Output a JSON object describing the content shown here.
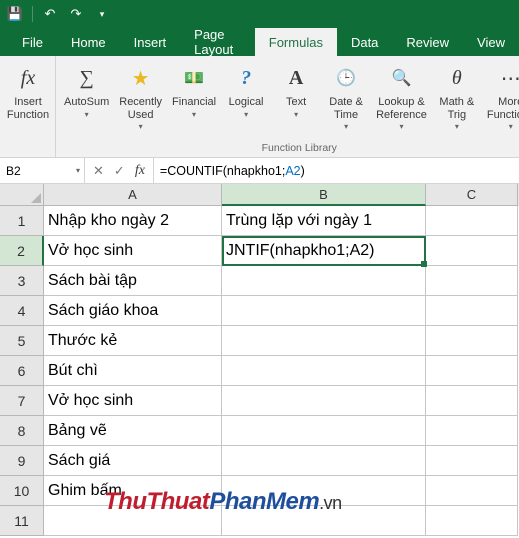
{
  "qat": {
    "save": "💾",
    "undo": "↶",
    "redo": "↷",
    "more": "▾"
  },
  "tabs": [
    "File",
    "Home",
    "Insert",
    "Page Layout",
    "Formulas",
    "Data",
    "Review",
    "View"
  ],
  "active_tab": 4,
  "ribbon": {
    "groups": [
      {
        "label": "",
        "buttons": [
          {
            "name": "insert-function",
            "icon": "fx",
            "label": "Insert\nFunction",
            "dd": false
          }
        ]
      },
      {
        "label": "Function Library",
        "buttons": [
          {
            "name": "autosum",
            "icon": "∑",
            "label": "AutoSum",
            "dd": true
          },
          {
            "name": "recently-used",
            "icon": "★",
            "label": "Recently\nUsed",
            "dd": true
          },
          {
            "name": "financial",
            "icon": "💵",
            "label": "Financial",
            "dd": true
          },
          {
            "name": "logical",
            "icon": "?",
            "label": "Logical",
            "dd": true
          },
          {
            "name": "text",
            "icon": "A",
            "label": "Text",
            "dd": true
          },
          {
            "name": "date-time",
            "icon": "🕒",
            "label": "Date &\nTime",
            "dd": true
          },
          {
            "name": "lookup-reference",
            "icon": "🔍",
            "label": "Lookup &\nReference",
            "dd": true
          },
          {
            "name": "math-trig",
            "icon": "θ",
            "label": "Math &\nTrig",
            "dd": true
          },
          {
            "name": "more-functions",
            "icon": "⋯",
            "label": "More\nFunctions",
            "dd": true
          }
        ]
      }
    ]
  },
  "namebox": "B2",
  "formula": {
    "pre": "=COUNTIF(nhapkho1;",
    "ref": "A2",
    "post": ")"
  },
  "cols": [
    "A",
    "B",
    "C"
  ],
  "rows": [
    {
      "n": "1",
      "a": "Nhập kho ngày 2",
      "b": "Trùng lặp với ngày 1",
      "c": ""
    },
    {
      "n": "2",
      "a": "Vở học sinh",
      "b": "JNTIF(nhapkho1;A2)",
      "c": ""
    },
    {
      "n": "3",
      "a": "Sách bài tập",
      "b": "",
      "c": ""
    },
    {
      "n": "4",
      "a": "Sách giáo khoa",
      "b": "",
      "c": ""
    },
    {
      "n": "5",
      "a": "Thước kẻ",
      "b": "",
      "c": ""
    },
    {
      "n": "6",
      "a": "Bút chì",
      "b": "",
      "c": ""
    },
    {
      "n": "7",
      "a": "Vở học sinh",
      "b": "",
      "c": ""
    },
    {
      "n": "8",
      "a": "Bảng vẽ",
      "b": "",
      "c": ""
    },
    {
      "n": "9",
      "a": "Sách giá",
      "b": "",
      "c": ""
    },
    {
      "n": "10",
      "a": "Ghim bấm",
      "b": "",
      "c": ""
    },
    {
      "n": "11",
      "a": "",
      "b": "",
      "c": ""
    }
  ],
  "watermark": {
    "a": "ThuThuat",
    "b": "PhanMem",
    "c": ".vn"
  }
}
